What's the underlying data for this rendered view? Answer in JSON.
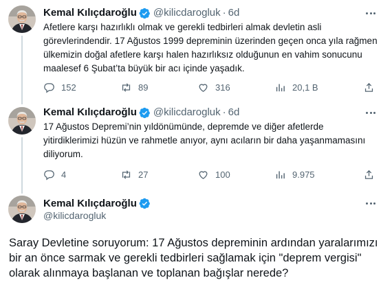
{
  "author": {
    "name": "Kemal Kılıçdaroğlu",
    "handle": "@kilicdarogluk",
    "dot": "·"
  },
  "tweets": [
    {
      "time": "6d",
      "text": "Afetlere karşı hazırlıklı olmak ve gerekli tedbirleri almak devletin asli görevlerindendir. 17 Ağustos 1999 depreminin üzerinden geçen onca yıla rağmen ülkemizin doğal afetlere karşı halen hazırlıksız olduğunun en vahim sonucunu maalesef 6 Şubat’ta büyük bir acı içinde yaşadık.",
      "replies": "152",
      "retweets": "89",
      "likes": "316",
      "views": "20,1 B"
    },
    {
      "time": "6d",
      "text": "17 Ağustos Depremi’nin yıldönümünde, depremde ve diğer afetlerde yitirdiklerimizi hüzün ve rahmetle anıyor, aynı acıların bir daha yaşanmamasını diliyorum.",
      "replies": "4",
      "retweets": "27",
      "likes": "100",
      "views": "9.975"
    }
  ],
  "main_tweet": {
    "text": "Saray Devletine soruyorum: 17 Ağustos depreminin ardından yaralarımızı bir an önce sarmak ve gerekli tedbirleri sağlamak için \"deprem vergisi\" olarak alınmaya başlanan ve toplanan bağışlar nerede?"
  },
  "icons": {
    "verified": "verified-badge-icon",
    "more": "more-options-icon",
    "reply": "reply-icon",
    "retweet": "retweet-icon",
    "like": "heart-icon",
    "views": "views-chart-icon",
    "share": "share-icon"
  },
  "colors": {
    "verified": "#1d9bf0",
    "text_primary": "#0f1419",
    "text_secondary": "#536471",
    "divider": "#eff3f4"
  }
}
